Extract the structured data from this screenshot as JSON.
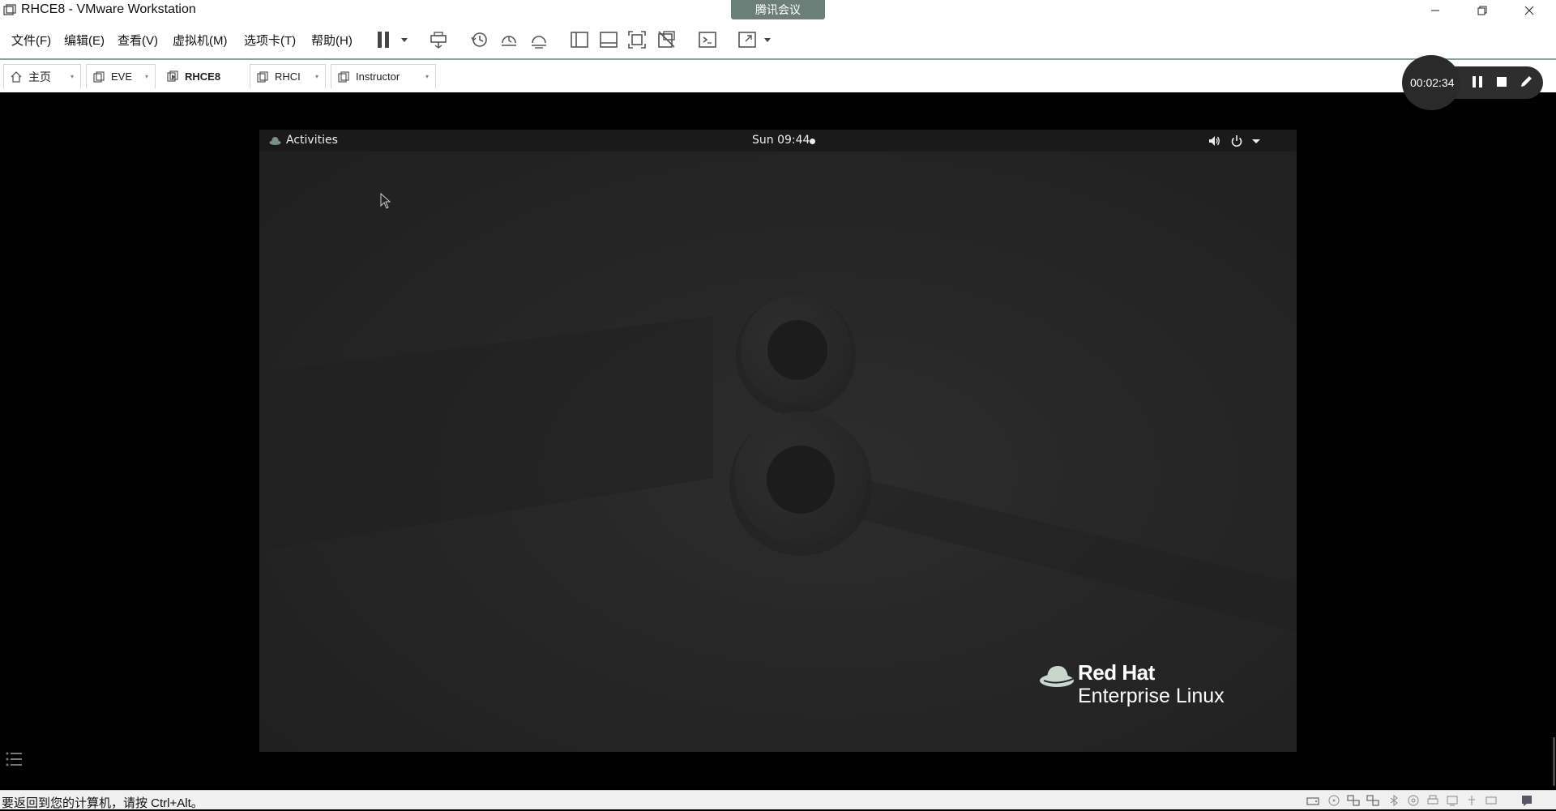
{
  "window": {
    "title": "RHCE8 - VMware Workstation",
    "meeting_tab": "腾讯会议"
  },
  "menu": {
    "items": [
      {
        "label": "文件(F)"
      },
      {
        "label": "编辑(E)"
      },
      {
        "label": "查看(V)"
      },
      {
        "label": "虚拟机(M)"
      },
      {
        "label": "选项卡(T)"
      },
      {
        "label": "帮助(H)"
      }
    ]
  },
  "toolbar": {
    "icons": [
      "pause-icon",
      "send-ctrl-alt-del-icon",
      "snapshot-icon",
      "revert-snapshot-icon",
      "snapshot-manager-icon",
      "library-view-icon",
      "thumbnail-bar-icon",
      "fullscreen-icon",
      "unity-icon",
      "console-icon",
      "stretch-icon"
    ]
  },
  "tabs": [
    {
      "label": "主页",
      "icon": "home-icon"
    },
    {
      "label": "EVE",
      "icon": "vm-icon"
    },
    {
      "label": "RHCE8",
      "icon": "vm-running-icon",
      "active": true
    },
    {
      "label": "RHCI",
      "icon": "vm-icon"
    },
    {
      "label": "Instructor",
      "icon": "vm-icon"
    }
  ],
  "recording": {
    "elapsed": "00:02:34"
  },
  "guest": {
    "activities_label": "Activities",
    "clock": "Sun 09:44",
    "brand_name": "Red Hat",
    "product_name": "Enterprise Linux",
    "wallpaper_number": "8"
  },
  "statusbar": {
    "message": "要返回到您的计算机，请按 Ctrl+Alt。"
  },
  "colors": {
    "accent_line": "#8aa39b",
    "meeting_tab_bg": "#6b7f78",
    "guest_bg": "#262626",
    "gnome_bar": "#1a1a1a"
  }
}
